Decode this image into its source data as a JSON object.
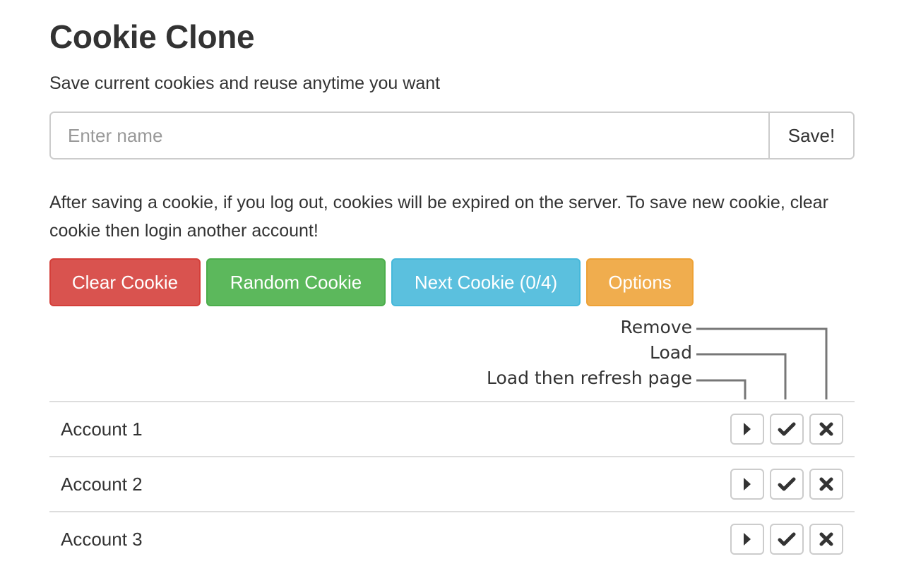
{
  "header": {
    "title": "Cookie Clone",
    "subtitle": "Save current cookies and reuse anytime you want"
  },
  "save_form": {
    "input_value": "",
    "input_placeholder": "Enter name",
    "save_label": "Save!"
  },
  "info_text": "After saving a cookie, if you log out, cookies will be expired on the server. To save new cookie, clear cookie then login another account!",
  "actions": {
    "clear_label": "Clear Cookie",
    "random_label": "Random Cookie",
    "next_label": "Next Cookie (0/4)",
    "options_label": "Options"
  },
  "legend": {
    "remove": "Remove",
    "load": "Load",
    "load_refresh": "Load then refresh page"
  },
  "accounts": [
    {
      "name": "Account 1",
      "icons": [
        "play-icon",
        "check-icon",
        "close-icon"
      ]
    },
    {
      "name": "Account 2",
      "icons": [
        "play-icon",
        "check-icon",
        "close-icon"
      ]
    },
    {
      "name": "Account 3",
      "icons": [
        "play-icon",
        "check-icon",
        "close-icon"
      ]
    }
  ],
  "colors": {
    "danger": "#d9534f",
    "success": "#5cb85c",
    "info": "#5bc0de",
    "warning": "#f0ad4e"
  }
}
